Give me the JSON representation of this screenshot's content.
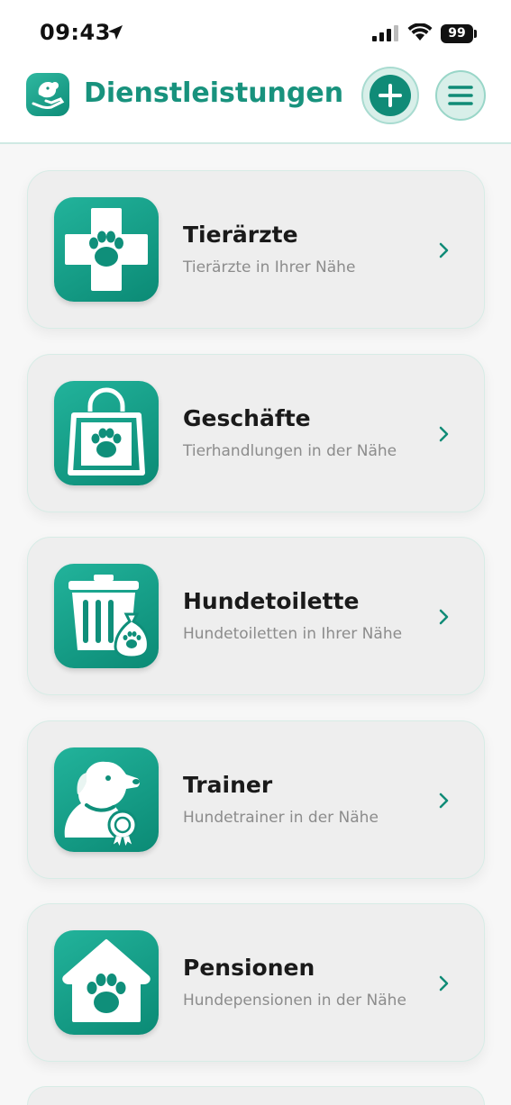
{
  "status_bar": {
    "time": "09:43",
    "battery": "99"
  },
  "header": {
    "title": "Dienstleistungen"
  },
  "colors": {
    "accent": "#18927d",
    "icon_gradient_start": "#22b39b",
    "icon_gradient_end": "#0b8a75"
  },
  "services": [
    {
      "title": "Tierärzte",
      "subtitle": "Tierärzte in Ihrer Nähe",
      "icon": "vet-cross-paw-icon"
    },
    {
      "title": "Geschäfte",
      "subtitle": "Tierhandlungen in der Nähe",
      "icon": "shopping-bag-paw-icon"
    },
    {
      "title": "Hundetoilette",
      "subtitle": "Hundetoiletten in Ihrer Nähe",
      "icon": "trash-bin-bag-icon"
    },
    {
      "title": "Trainer",
      "subtitle": "Hundetrainer in der Nähe",
      "icon": "dog-medal-icon"
    },
    {
      "title": "Pensionen",
      "subtitle": "Hundepensionen in der Nähe",
      "icon": "house-paw-icon"
    }
  ]
}
